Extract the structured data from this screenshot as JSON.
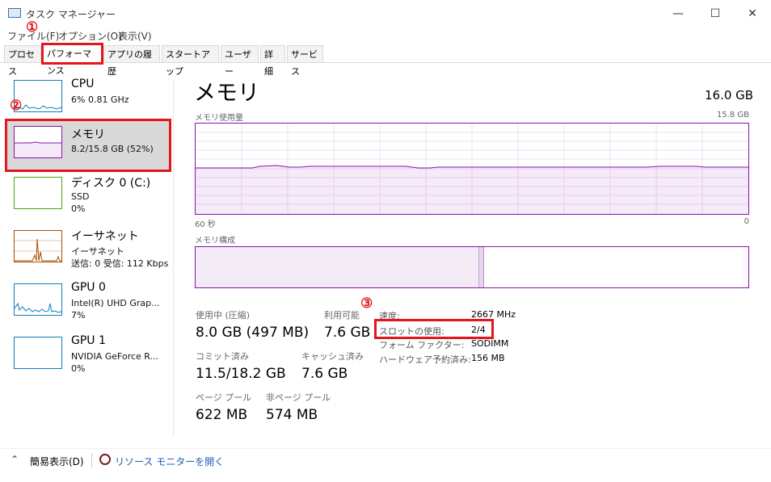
{
  "window": {
    "title": "タスク マネージャー",
    "minimize": "—",
    "maximize": "☐",
    "close": "✕"
  },
  "menu": [
    "ファイル(F)",
    "オプション(O)",
    "表示(V)"
  ],
  "tabs": [
    "プロセス",
    "パフォーマンス",
    "アプリの履歴",
    "スタートアップ",
    "ユーザー",
    "詳細",
    "サービス"
  ],
  "annotations": [
    "①",
    "②",
    "③"
  ],
  "sidebar": [
    {
      "title": "CPU",
      "sub1": "6%  0.81 GHz",
      "sub2": "",
      "sub3": ""
    },
    {
      "title": "メモリ",
      "sub1": "8.2/15.8 GB (52%)",
      "sub2": "",
      "sub3": ""
    },
    {
      "title": "ディスク 0 (C:)",
      "sub1": "SSD",
      "sub2": "0%",
      "sub3": ""
    },
    {
      "title": "イーサネット",
      "sub1": "イーサネット",
      "sub2": "送信: 0  受信: 112 Kbps",
      "sub3": ""
    },
    {
      "title": "GPU 0",
      "sub1": "Intel(R) UHD Grap...",
      "sub2": "7%",
      "sub3": ""
    },
    {
      "title": "GPU 1",
      "sub1": "NVIDIA GeForce R...",
      "sub2": "0%",
      "sub3": ""
    }
  ],
  "main": {
    "title": "メモリ",
    "total": "16.0 GB",
    "usage_label": "メモリ使用量",
    "usage_max": "15.8 GB",
    "time_left": "60 秒",
    "time_right": "0",
    "composition_label": "メモリ構成",
    "usage_fraction": 0.52
  },
  "stats": {
    "in_use_label": "使用中 (圧縮)",
    "in_use_value": "8.0 GB (497 MB)",
    "available_label": "利用可能",
    "available_value": "7.6 GB",
    "committed_label": "コミット済み",
    "committed_value": "11.5/18.2 GB",
    "cached_label": "キャッシュ済み",
    "cached_value": "7.6 GB",
    "paged_label": "ページ プール",
    "paged_value": "622 MB",
    "nonpaged_label": "非ページ プール",
    "nonpaged_value": "574 MB"
  },
  "details": [
    {
      "label": "速度:",
      "value": "2667 MHz"
    },
    {
      "label": "スロットの使用:",
      "value": "2/4"
    },
    {
      "label": "フォーム ファクター:",
      "value": "SODIMM"
    },
    {
      "label": "ハードウェア予約済み:",
      "value": "156 MB"
    }
  ],
  "footer": {
    "fewer_details": "簡易表示(D)",
    "resource_monitor": "リソース モニターを開く"
  },
  "colors": {
    "memory": "#8b12ae",
    "cpu": "#117dbb",
    "disk": "#4da60c",
    "ethernet": "#a74f01",
    "annotation": "#e4161b"
  }
}
